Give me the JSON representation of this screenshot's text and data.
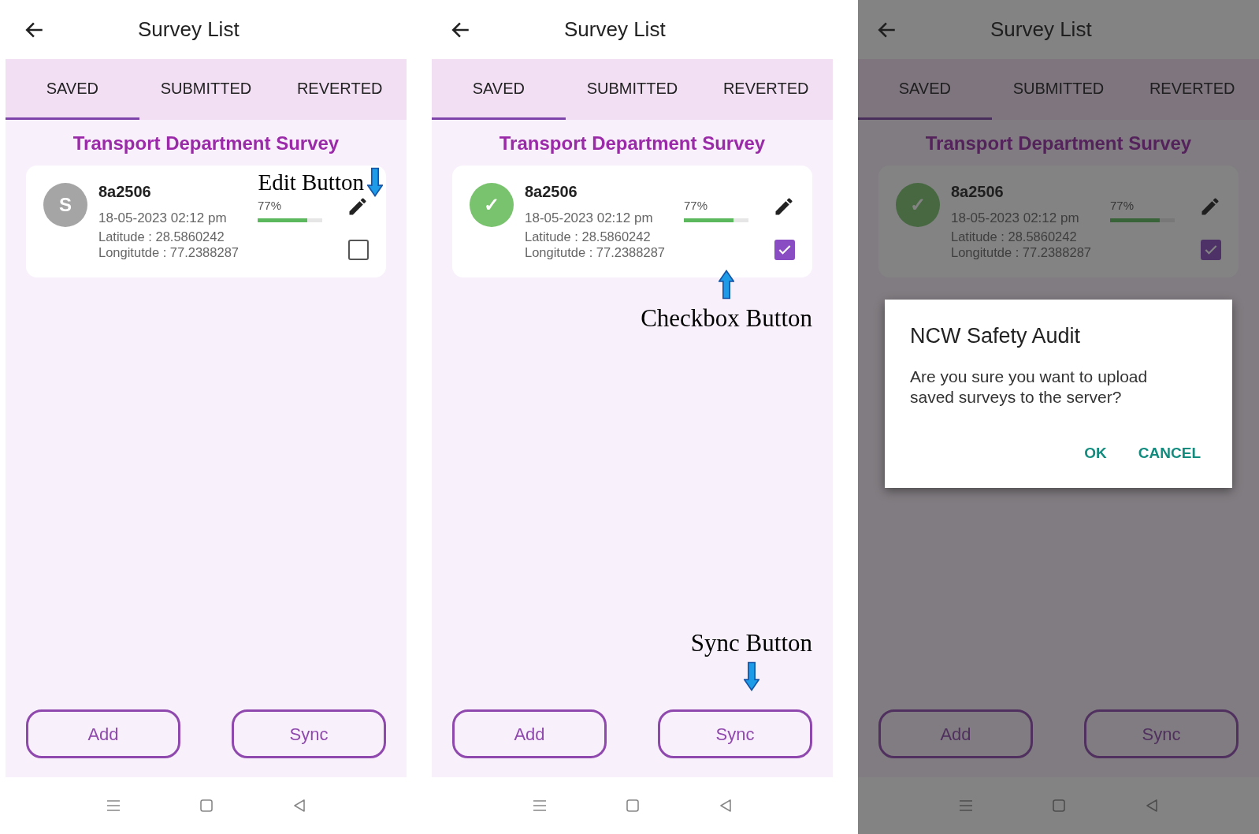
{
  "panels": [
    {
      "header": {
        "title": "Survey List"
      },
      "tabs": [
        {
          "label": "SAVED",
          "selected": true
        },
        {
          "label": "SUBMITTED",
          "selected": false
        },
        {
          "label": "REVERTED",
          "selected": false
        }
      ],
      "section_title": "Transport Department Survey",
      "surveys": [
        {
          "avatar": {
            "kind": "letter",
            "text": "S"
          },
          "id": "8a2506",
          "date": "18-05-2023 02:12 pm",
          "latitude": "Latitude : 28.5860242",
          "longitude": "Longitutde : 77.2388287",
          "progress": "77%",
          "level": 0.77,
          "checked": false,
          "edit_note": "Edit Button"
        }
      ],
      "buttons": [
        {
          "label": "Add"
        },
        {
          "label": "Sync"
        }
      ]
    },
    {
      "header": {
        "title": "Survey List"
      },
      "tabs": [
        {
          "label": "SAVED",
          "selected": true
        },
        {
          "label": "SUBMITTED",
          "selected": false
        },
        {
          "label": "REVERTED",
          "selected": false
        }
      ],
      "section_title": "Transport Department Survey",
      "surveys": [
        {
          "avatar": {
            "kind": "done",
            "text": "✓"
          },
          "id": "8a2506",
          "date": "18-05-2023 02:12 pm",
          "latitude": "Latitude : 28.5860242",
          "longitude": "Longitutde : 77.2388287",
          "progress": "77%",
          "level": 0.77,
          "checked": true,
          "checkbox_note": "Checkbox Button"
        }
      ],
      "buttons": [
        {
          "label": "Add"
        },
        {
          "label": "Sync",
          "note": "Sync Button"
        }
      ]
    },
    {
      "header": {
        "title": "Survey List"
      },
      "tabs": [
        {
          "label": "SAVED",
          "selected": true
        },
        {
          "label": "SUBMITTED",
          "selected": false
        },
        {
          "label": "REVERTED",
          "selected": false
        }
      ],
      "section_title": "Transport Department Survey",
      "surveys": [
        {
          "avatar": {
            "kind": "done",
            "text": "✓"
          },
          "id": "8a2506",
          "date": "18-05-2023 02:12 pm",
          "latitude": "Latitude : 28.5860242",
          "longitude": "Longitutde : 77.2388287",
          "progress": "77%",
          "level": 0.77,
          "checked": true
        }
      ],
      "buttons": [
        {
          "label": "Add"
        },
        {
          "label": "Sync"
        }
      ],
      "dialog": {
        "title": "NCW Safety Audit",
        "message": "Are you sure you want to upload saved surveys to the server?",
        "actions": [
          "OK",
          "CANCEL"
        ]
      }
    }
  ]
}
